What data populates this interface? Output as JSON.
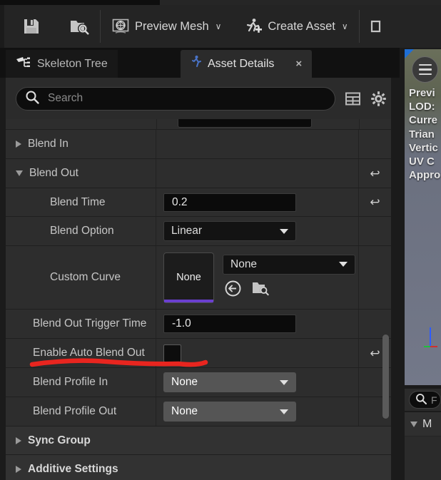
{
  "toolbar": {
    "buttons": [
      {
        "label": "",
        "icon": "save-icon"
      },
      {
        "label": "",
        "icon": "browse-folder-search-icon"
      },
      {
        "label": "Preview Mesh",
        "icon": "preview-mesh-icon",
        "caret": "∨"
      },
      {
        "label": "Create Asset",
        "icon": "create-asset-icon",
        "caret": "∨"
      }
    ]
  },
  "tabs": [
    {
      "label": "Skeleton Tree",
      "icon": "skeleton-tree-icon",
      "active": false
    },
    {
      "label": "Asset Details",
      "icon": "asset-details-icon",
      "active": true,
      "close": "×"
    }
  ],
  "search": {
    "value": "",
    "placeholder": "Search",
    "icons": [
      "search-icon",
      "column-layout-icon",
      "settings-gear-icon"
    ]
  },
  "properties": {
    "rows": [
      {
        "name": "Blend In",
        "type": "category-sub",
        "expanded": false,
        "value": "",
        "reset": false
      },
      {
        "name": "Blend Out",
        "type": "category-sub",
        "expanded": true,
        "value": "",
        "reset": true
      },
      {
        "name": "Blend Time",
        "type": "number",
        "value": "0.2",
        "reset": true
      },
      {
        "name": "Blend Option",
        "type": "dropdown",
        "value": "Linear",
        "reset": false
      },
      {
        "name": "Custom Curve",
        "type": "object-picker",
        "thumbnail": "None",
        "value": "None",
        "reset": false
      },
      {
        "name": "Blend Out Trigger Time",
        "type": "number",
        "value": "-1.0",
        "reset": false
      },
      {
        "name": "Enable Auto Blend Out",
        "type": "checkbox",
        "checked": false,
        "value": "",
        "reset": true
      },
      {
        "name": "Blend Profile In",
        "type": "dropdown-light",
        "value": "None",
        "reset": false
      },
      {
        "name": "Blend Profile Out",
        "type": "dropdown-light",
        "value": "None",
        "reset": false
      },
      {
        "name": "Sync Group",
        "type": "category",
        "expanded": false,
        "value": "",
        "reset": false
      },
      {
        "name": "Additive Settings",
        "type": "category",
        "expanded": false,
        "value": "",
        "reset": false
      }
    ],
    "reset_glyph": "↩"
  },
  "viewport": {
    "menu_icon": "hamburger-menu-icon",
    "stats": [
      "Previ",
      "LOD:",
      "Curre",
      "Trian",
      "Vertic",
      "UV C",
      "Appro"
    ],
    "search_placeholder": "F",
    "tree_item": "M"
  },
  "annotation": {
    "color": "#e8251f",
    "shape": "hand-drawn-underline",
    "target": "Enable Auto Blend Out"
  },
  "colors": {
    "panel_bg": "#2b2b2b",
    "row_bg": "#2d2d2d",
    "category_bg": "#323232",
    "field_bg": "#0b0b0b",
    "accent_purple": "#6a3fd0",
    "annotation_red": "#e8251f"
  }
}
